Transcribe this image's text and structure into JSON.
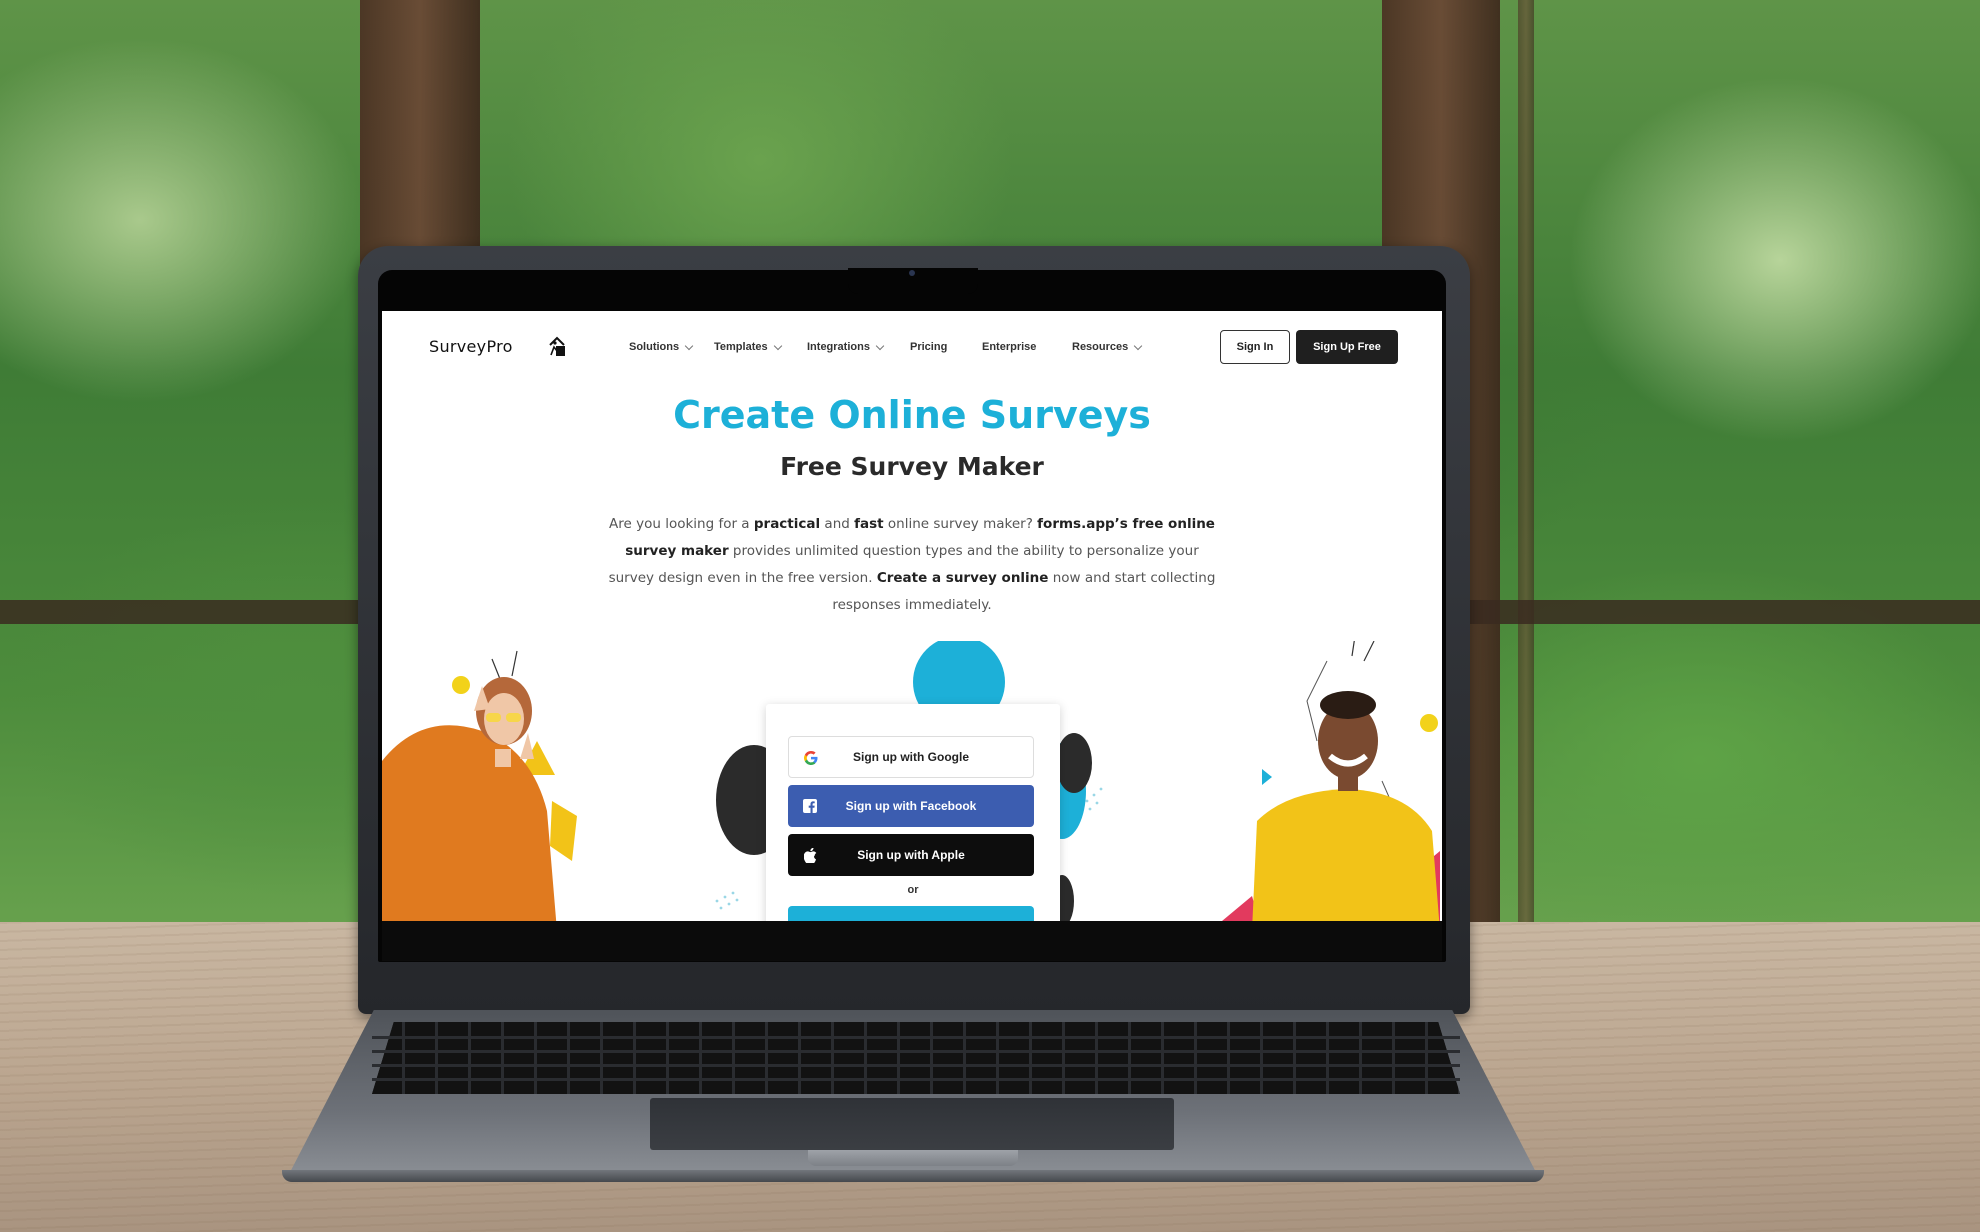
{
  "nav": {
    "logo": "SurveyPro",
    "menu": [
      {
        "label": "Solutions",
        "dropdown": true
      },
      {
        "label": "Templates",
        "dropdown": true
      },
      {
        "label": "Integrations",
        "dropdown": true
      },
      {
        "label": "Pricing",
        "dropdown": false
      },
      {
        "label": "Enterprise",
        "dropdown": false
      },
      {
        "label": "Resources",
        "dropdown": true
      }
    ],
    "sign_in": "Sign In",
    "sign_up": "Sign Up Free"
  },
  "hero": {
    "title": "Create Online Surveys",
    "subtitle": "Free Survey Maker",
    "desc": {
      "p1": "Are you looking for a ",
      "b1": "practical",
      "p2": " and ",
      "b2": "fast",
      "p3": " online survey maker? ",
      "b3": "forms.app’s free online survey maker",
      "p4": " provides unlimited question types and the ability to personalize your survey design even in the free version. ",
      "b4": "Create a survey online",
      "p5": " now and start collecting responses immediately."
    }
  },
  "signup_card": {
    "google": "Sign up with Google",
    "facebook": "Sign up with Facebook",
    "apple": "Sign up with Apple",
    "or": "or"
  },
  "colors": {
    "accent": "#1db0d8",
    "facebook": "#3c5db0",
    "yellow": "#f2c318",
    "orange": "#e07a1f"
  }
}
